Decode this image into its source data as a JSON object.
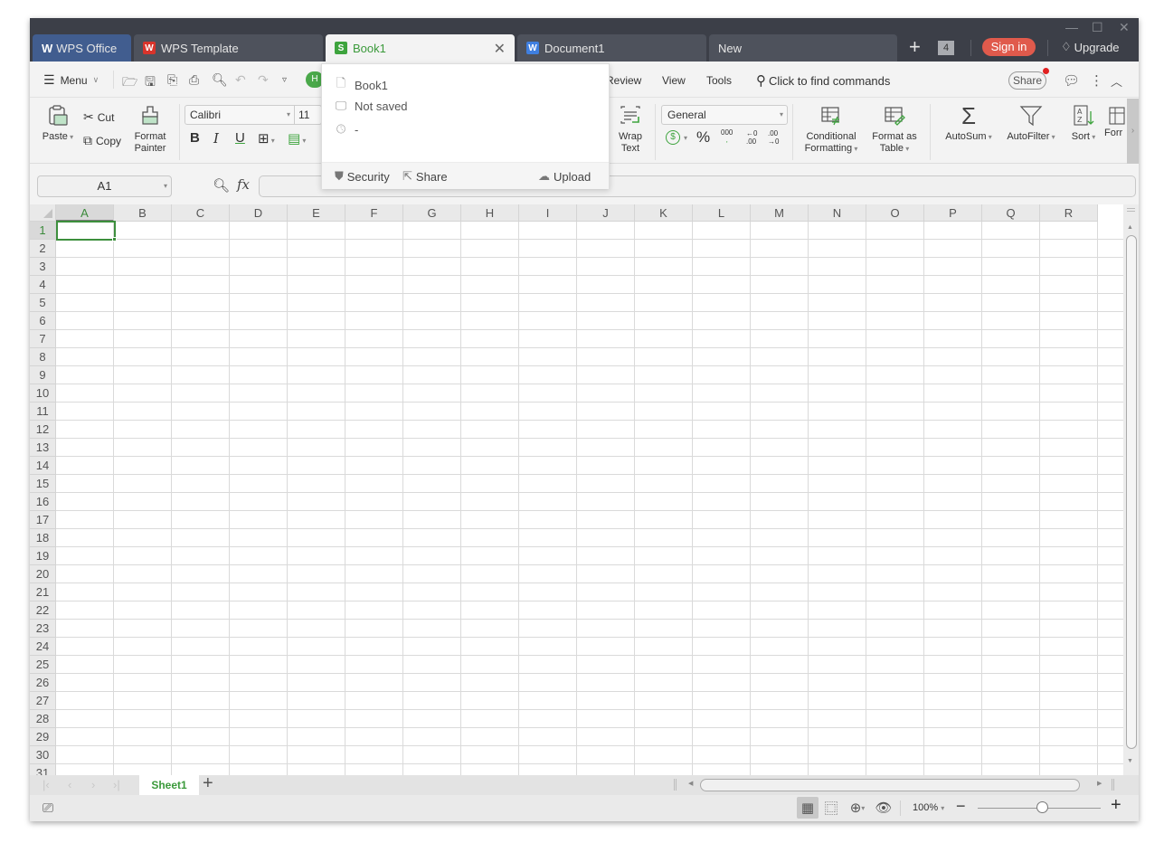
{
  "titlebar": {
    "tabs": [
      {
        "label": "WPS Office",
        "icon": "wps-logo-icon"
      },
      {
        "label": "WPS Template",
        "icon": "wps-template-icon"
      },
      {
        "label": "Book1",
        "icon": "spreadsheet-icon",
        "active": true
      },
      {
        "label": "Document1",
        "icon": "writer-doc-icon"
      },
      {
        "label": "New"
      }
    ],
    "tab_count": "4",
    "sign_in": "Sign in",
    "upgrade": "Upgrade"
  },
  "menubar": {
    "menu_label": "Menu",
    "home_pill": "H",
    "tabs": [
      "Review",
      "View",
      "Tools"
    ],
    "find_commands": "Click to find commands",
    "share": "Share"
  },
  "ribbon": {
    "paste": "Paste",
    "cut": "Cut",
    "copy": "Copy",
    "format_painter_1": "Format",
    "format_painter_2": "Painter",
    "font_name": "Calibri",
    "font_size": "11",
    "bold": "B",
    "italic": "I",
    "underline": "U",
    "wrap_text_1": "Wrap",
    "wrap_text_2": "Text",
    "number_format": "General",
    "percent": "%",
    "thousands": "000",
    "inc_decimal": "←0 .00",
    "dec_decimal": ".00 →0",
    "conditional_1": "Conditional",
    "conditional_2": "Formatting",
    "format_table_1": "Format as",
    "format_table_2": "Table",
    "autosum": "AutoSum",
    "autofilter": "AutoFilter",
    "sort": "Sort",
    "format_cut": "Forr"
  },
  "formula_bar": {
    "name_box": "A1",
    "fx": "fx",
    "formula": ""
  },
  "grid": {
    "columns": [
      "A",
      "B",
      "C",
      "D",
      "E",
      "F",
      "G",
      "H",
      "I",
      "J",
      "K",
      "L",
      "M",
      "N",
      "O",
      "P",
      "Q",
      "R"
    ],
    "rows": [
      "1",
      "2",
      "3",
      "4",
      "5",
      "6",
      "7",
      "8",
      "9",
      "10",
      "11",
      "12",
      "13",
      "14",
      "15",
      "16",
      "17",
      "18",
      "19",
      "20",
      "21",
      "22",
      "23",
      "24",
      "25",
      "26",
      "27",
      "28",
      "29",
      "30",
      "31"
    ],
    "selected_cell": "A1"
  },
  "sheets": {
    "tabs": [
      "Sheet1"
    ],
    "active": "Sheet1"
  },
  "statusbar": {
    "zoom_label": "100%",
    "zoom_percent": 100
  },
  "popup": {
    "file_name": "Book1",
    "save_status": "Not saved",
    "last_modified": "-",
    "security": "Security",
    "share": "Share",
    "upload": "Upload"
  }
}
